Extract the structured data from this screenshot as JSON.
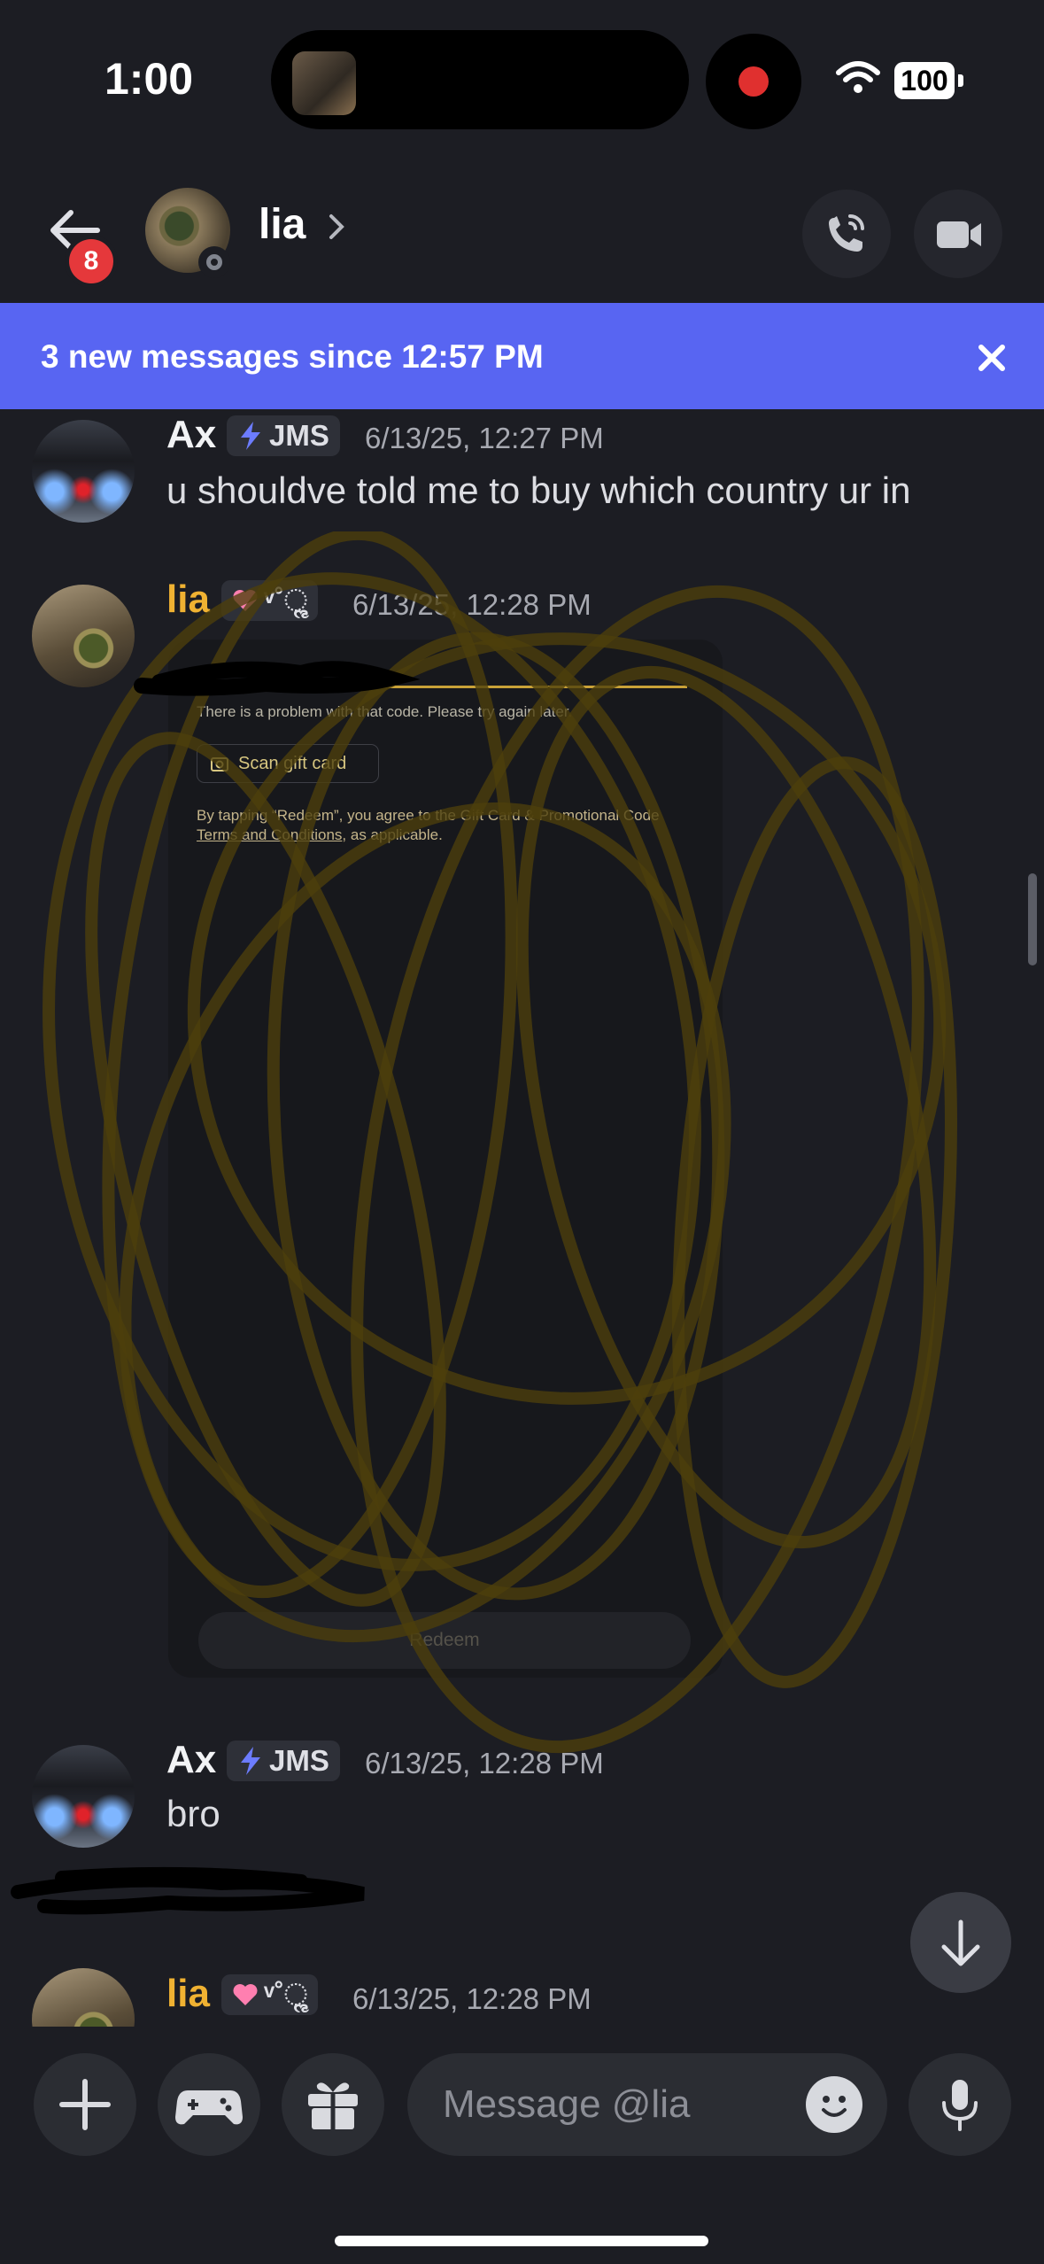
{
  "status_bar": {
    "time": "1:00",
    "battery": "100"
  },
  "header": {
    "unread_count": "8",
    "contact_name": "lia"
  },
  "banner": {
    "text": "3 new messages since 12:57 PM"
  },
  "messages": [
    {
      "author": "Ax",
      "tag": "JMS",
      "timestamp": "6/13/25, 12:27 PM",
      "text": "u shouldve told me to buy which country ur in"
    },
    {
      "author": "lia",
      "tag": "ᵛ˚ૢ",
      "timestamp": "6/13/25, 12:28 PM"
    },
    {
      "author": "Ax",
      "tag": "JMS",
      "timestamp": "6/13/25, 12:28 PM",
      "text": "bro"
    },
    {
      "author": "lia",
      "tag": "ᵛ˚ૢ",
      "timestamp": "6/13/25, 12:28 PM"
    }
  ],
  "attachment": {
    "error_text": "There is a problem with that code. Please try again later.",
    "scan_button": "Scan gift card",
    "terms_prefix": "By tapping “Redeem”, you agree to the Gift Card & Promotional Code ",
    "terms_link": "Terms and Conditions",
    "terms_suffix": ", as applicable.",
    "redeem_button": "Redeem"
  },
  "composer": {
    "placeholder": "Message @lia"
  },
  "colors": {
    "banner": "#5865f2",
    "lia_name": "#f0b232",
    "badge": "#e5383b",
    "recording": "#e0302f"
  },
  "icons": [
    "back-arrow-icon",
    "chevron-right-icon",
    "phone-call-icon",
    "video-camera-icon",
    "close-icon",
    "lightning-icon",
    "heart-icon",
    "camera-icon",
    "arrow-down-icon",
    "plus-icon",
    "gamepad-icon",
    "gift-icon",
    "smiley-icon",
    "microphone-icon",
    "wifi-icon"
  ]
}
